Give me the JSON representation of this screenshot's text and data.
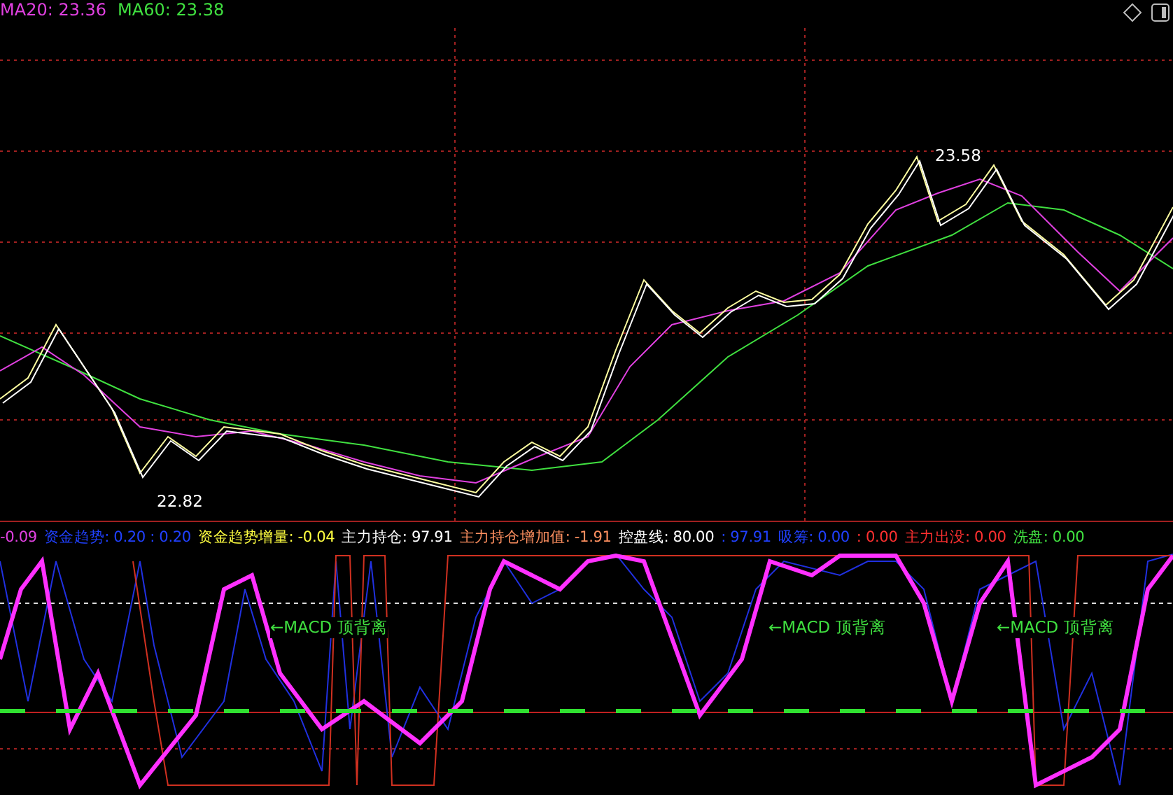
{
  "ma_legend": [
    {
      "text": "MA20: 23.36",
      "color": "#e040e0"
    },
    {
      "text": "MA60: 23.38",
      "color": "#40e040"
    }
  ],
  "price_labels": [
    "23.58",
    "22.82"
  ],
  "indicator_header": [
    {
      "text": "-0.09",
      "color": "#e040e0"
    },
    {
      "text": "资金趋势: 0.20 : 0.20",
      "color": "#2040ff"
    },
    {
      "text": "资金趋势增量: -0.04",
      "color": "#ffff40"
    },
    {
      "text": "主力持仓: 97.91",
      "color": "#ffffff"
    },
    {
      "text": "主力持仓增加值: -1.91",
      "color": "#ff9060"
    },
    {
      "text": "控盘线: 80.00",
      "color": "#ffffff"
    },
    {
      "text": ": 97.91",
      "color": "#2040ff"
    },
    {
      "text": "吸筹: 0.00",
      "color": "#2040ff"
    },
    {
      "text": ": 0.00",
      "color": "#ff3030"
    },
    {
      "text": "主力出没: 0.00",
      "color": "#ff3030"
    },
    {
      "text": "洗盘: 0.00",
      "color": "#40e040"
    }
  ],
  "annotations": [
    "←MACD 顶背离",
    "←MACD 顶背离",
    "←MACD 顶背离"
  ]
}
